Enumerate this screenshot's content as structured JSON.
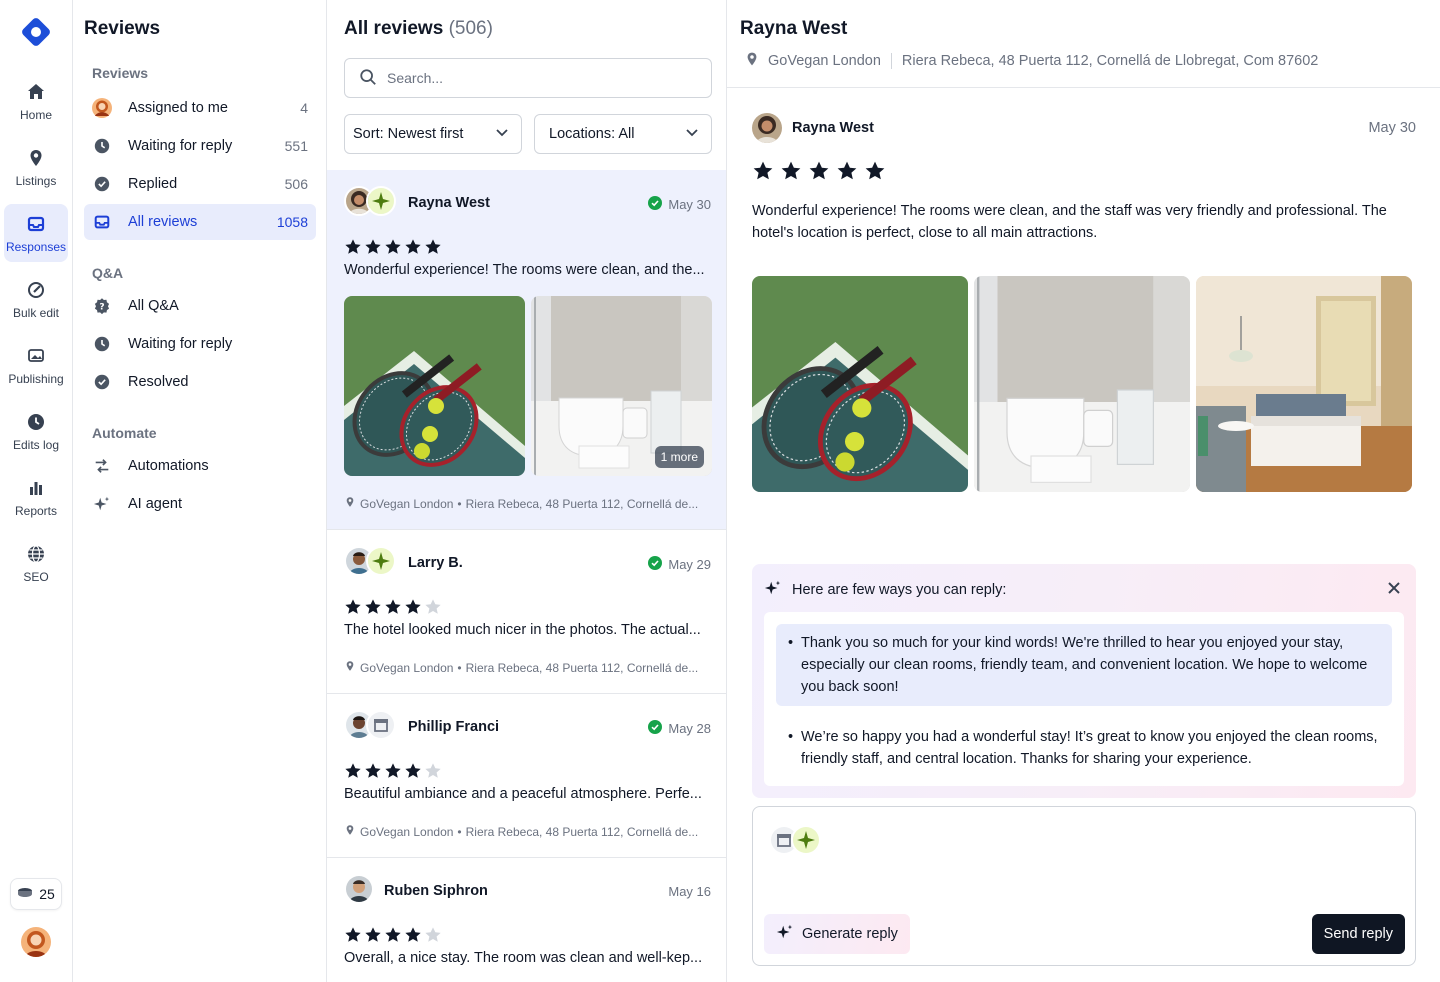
{
  "rail": {
    "items": [
      {
        "label": "Home",
        "icon": "home-icon"
      },
      {
        "label": "Listings",
        "icon": "map-pin-icon"
      },
      {
        "label": "Responses",
        "icon": "inbox-icon"
      },
      {
        "label": "Bulk edit",
        "icon": "bulk-edit-icon"
      },
      {
        "label": "Publishing",
        "icon": "images-icon"
      },
      {
        "label": "Edits log",
        "icon": "clock-icon"
      },
      {
        "label": "Reports",
        "icon": "bar-chart-icon"
      },
      {
        "label": "SEO",
        "icon": "globe-icon"
      }
    ],
    "active": "Responses",
    "credits": "25"
  },
  "nav": {
    "title": "Reviews",
    "sections": [
      {
        "title": "Reviews",
        "items": [
          {
            "label": "Assigned to me",
            "count": "4",
            "icon": "user-avatar-icon"
          },
          {
            "label": "Waiting for reply",
            "count": "551",
            "icon": "clock-icon"
          },
          {
            "label": "Replied",
            "count": "506",
            "icon": "check-circle-icon"
          },
          {
            "label": "All reviews",
            "count": "1058",
            "icon": "inbox-icon"
          }
        ]
      },
      {
        "title": "Q&A",
        "items": [
          {
            "label": "All Q&A",
            "icon": "question-badge-icon"
          },
          {
            "label": "Waiting for reply",
            "icon": "clock-icon"
          },
          {
            "label": "Resolved",
            "icon": "check-circle-icon"
          }
        ]
      },
      {
        "title": "Automate",
        "items": [
          {
            "label": "Automations",
            "icon": "automation-icon"
          },
          {
            "label": "AI agent",
            "icon": "sparkle-icon"
          }
        ]
      }
    ]
  },
  "list": {
    "title": "All reviews",
    "count": "(506)",
    "search_placeholder": "Search...",
    "sort_label": "Sort: Newest first",
    "locations_label": "Locations: All",
    "reviews": [
      {
        "name": "Rayna West",
        "date": "May 30",
        "replied": true,
        "stars": 5,
        "text": "Wonderful experience! The rooms were clean, and the...",
        "location": "GoVegan London",
        "address": "Riera Rebeca, 48 Puerta 112, Cornellá de...",
        "more": "1 more"
      },
      {
        "name": "Larry B.",
        "date": "May 29",
        "replied": true,
        "stars": 4,
        "text": "The hotel looked much nicer in the photos. The actual...",
        "location": "GoVegan London",
        "address": "Riera Rebeca, 48 Puerta 112, Cornellá de..."
      },
      {
        "name": "Phillip Franci",
        "date": "May 28",
        "replied": true,
        "stars": 4,
        "text": "Beautiful ambiance and a peaceful atmosphere. Perfe...",
        "location": "GoVegan London",
        "address": "Riera Rebeca, 48 Puerta 112, Cornellá de..."
      },
      {
        "name": "Ruben Siphron",
        "date": "May 16",
        "replied": false,
        "stars": 4,
        "text": "Overall, a nice stay. The room was clean and well-kep..."
      }
    ]
  },
  "detail": {
    "name": "Rayna West",
    "location": "GoVegan London",
    "address": "Riera Rebeca, 48 Puerta 112, Cornellá de Llobregat, Com 87602",
    "author": "Rayna West",
    "date": "May 30",
    "stars": 5,
    "text": "Wonderful experience! The rooms were clean, and the staff was very friendly and professional. The hotel's location is perfect, close to all main attractions.",
    "ai": {
      "heading": "Here are few ways you can reply:",
      "suggestions": [
        "Thank you so much for your kind words! We're thrilled to hear you enjoyed your stay, especially our clean rooms, friendly team, and convenient location. We hope to welcome you back soon!",
        "We’re so happy you had a wonderful stay! It’s great to know you enjoyed the clean rooms, friendly staff, and central location. Thanks for sharing your experience."
      ]
    },
    "generate_label": "Generate reply",
    "send_label": "Send reply"
  },
  "colors": {
    "accent": "#1d3fd6",
    "active_bg": "#e8ecfc",
    "star": "#111827",
    "star_empty": "#d1d5db",
    "replied": "#16a34a"
  }
}
